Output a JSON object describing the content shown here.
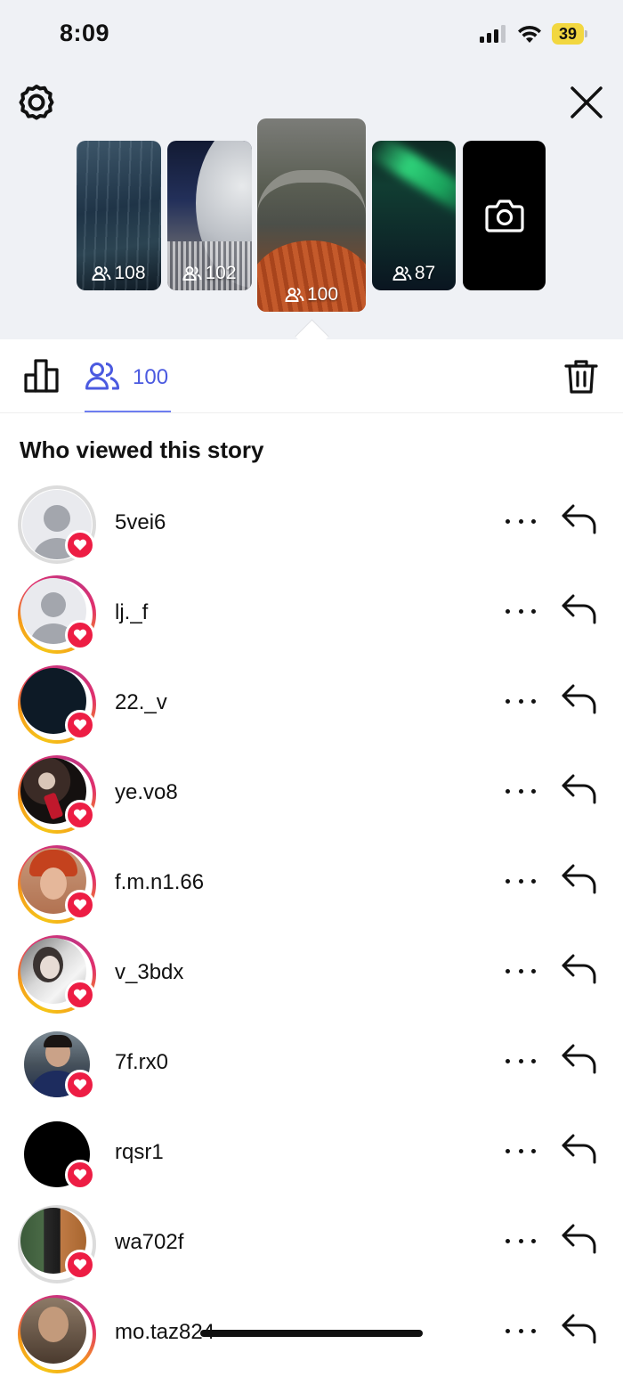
{
  "status_bar": {
    "time": "8:09",
    "battery": "39"
  },
  "stories": [
    {
      "viewers": "108"
    },
    {
      "viewers": "102"
    },
    {
      "viewers": "100",
      "selected": true
    },
    {
      "viewers": "87"
    },
    {
      "type": "camera"
    }
  ],
  "tabs": {
    "viewers_count": "100"
  },
  "list_title": "Who viewed this story",
  "viewers": [
    {
      "username": "5vei6",
      "ring": "seen",
      "avatar": "default"
    },
    {
      "username": "lj._f",
      "ring": "story",
      "avatar": "default"
    },
    {
      "username": "22._v",
      "ring": "story",
      "avatar": "dark"
    },
    {
      "username": "ye.vo8",
      "ring": "story",
      "avatar": "photo"
    },
    {
      "username": "f.m.n1.66",
      "ring": "story",
      "avatar": "photo"
    },
    {
      "username": "v_3bdx",
      "ring": "story",
      "avatar": "photo"
    },
    {
      "username": "7f.rx0",
      "ring": "none",
      "avatar": "photo"
    },
    {
      "username": "rqsr1",
      "ring": "none",
      "avatar": "black"
    },
    {
      "username": "wa702f",
      "ring": "seen",
      "avatar": "photo"
    },
    {
      "username": "mo.taz824",
      "ring": "story",
      "avatar": "photo"
    }
  ],
  "colors": {
    "accent": "#4b5ae0",
    "like": "#ed1d44",
    "panel": "#eff1f5"
  }
}
